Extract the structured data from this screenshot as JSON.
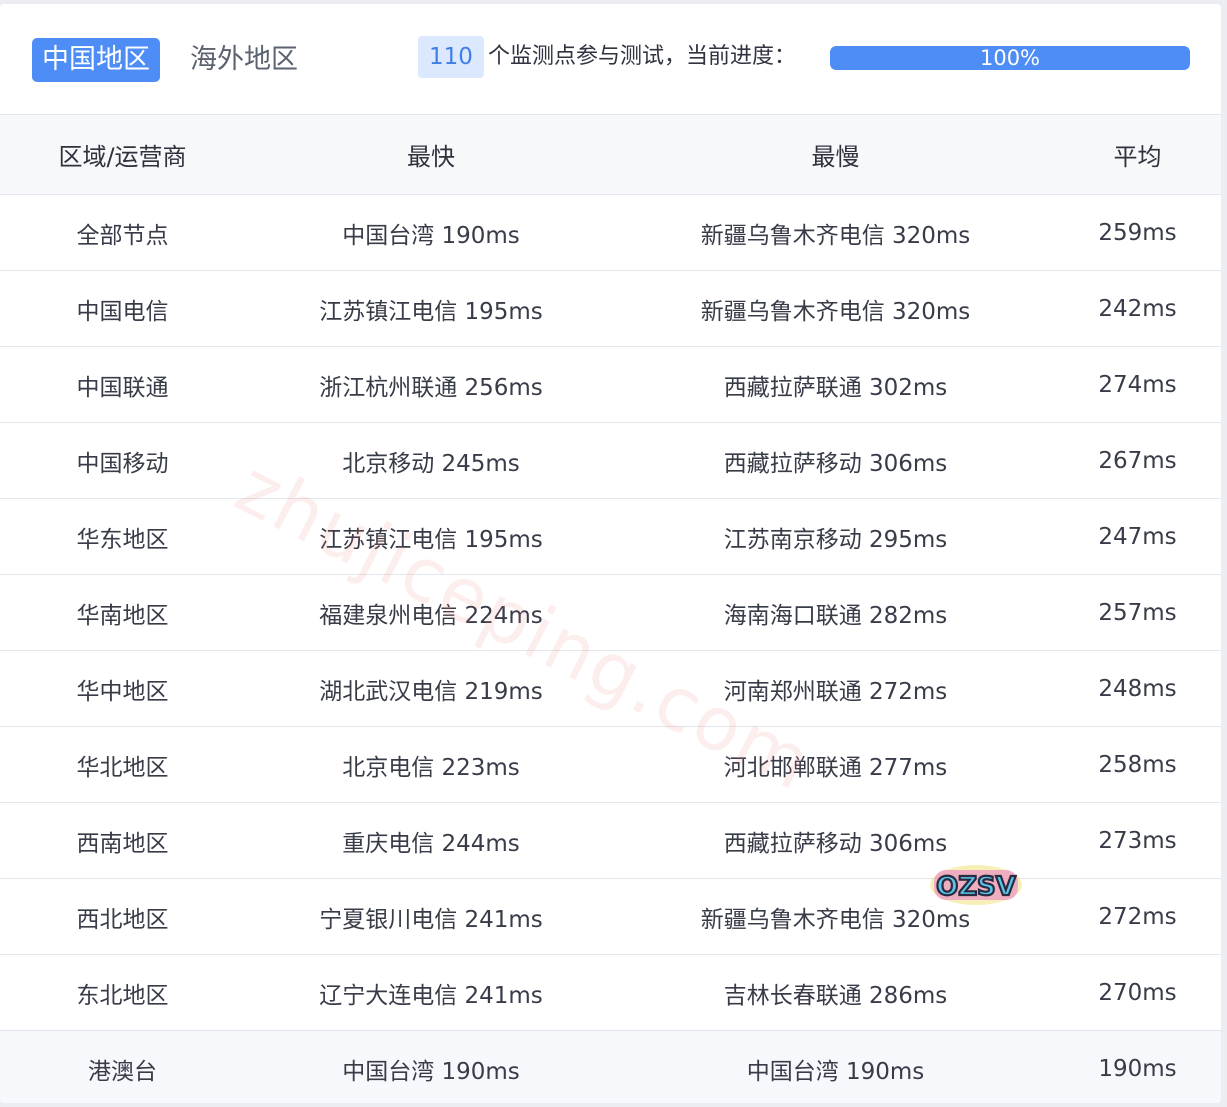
{
  "tabs": {
    "china": "中国地区",
    "overseas": "海外地区"
  },
  "status": {
    "node_count": "110",
    "progress_text": "个监测点参与测试，当前进度：",
    "progress_label": "100%",
    "progress_value": 1.0
  },
  "table": {
    "headers": [
      "区域/运营商",
      "最快",
      "最慢",
      "平均"
    ],
    "rows": [
      [
        "全部节点",
        "中国台湾 190ms",
        "新疆乌鲁木齐电信 320ms",
        "259ms"
      ],
      [
        "中国电信",
        "江苏镇江电信 195ms",
        "新疆乌鲁木齐电信 320ms",
        "242ms"
      ],
      [
        "中国联通",
        "浙江杭州联通 256ms",
        "西藏拉萨联通 302ms",
        "274ms"
      ],
      [
        "中国移动",
        "北京移动 245ms",
        "西藏拉萨移动 306ms",
        "267ms"
      ],
      [
        "华东地区",
        "江苏镇江电信 195ms",
        "江苏南京移动 295ms",
        "247ms"
      ],
      [
        "华南地区",
        "福建泉州电信 224ms",
        "海南海口联通 282ms",
        "257ms"
      ],
      [
        "华中地区",
        "湖北武汉电信 219ms",
        "河南郑州联通 272ms",
        "248ms"
      ],
      [
        "华北地区",
        "北京电信 223ms",
        "河北邯郸联通 277ms",
        "258ms"
      ],
      [
        "西南地区",
        "重庆电信 244ms",
        "西藏拉萨移动 306ms",
        "273ms"
      ],
      [
        "西北地区",
        "宁夏银川电信 241ms",
        "新疆乌鲁木齐电信 320ms",
        "272ms"
      ],
      [
        "东北地区",
        "辽宁大连电信 241ms",
        "吉林长春联通 286ms",
        "270ms"
      ],
      [
        "港澳台",
        "中国台湾 190ms",
        "中国台湾 190ms",
        "190ms"
      ]
    ]
  },
  "watermark": {
    "text": "zhujiceping.com",
    "logo_text": "OZSV"
  },
  "colors": {
    "accent": "#4d8df5",
    "badge_bg": "#dbe8fd"
  }
}
